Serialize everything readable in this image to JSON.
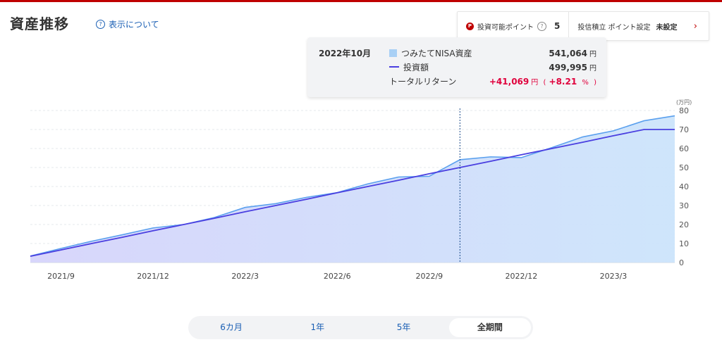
{
  "header": {
    "title": "資産推移",
    "about_label": "表示について"
  },
  "points_panel": {
    "points_label": "投資可能ポイント",
    "points_value": "5",
    "setting_label": "投信積立 ポイント設定",
    "setting_value": "未設定"
  },
  "tooltip": {
    "date": "2022年10月",
    "rows": [
      {
        "label": "つみたてNISA資産",
        "value": "541,064",
        "unit": "円"
      },
      {
        "label": "投資額",
        "value": "499,995",
        "unit": "円"
      }
    ],
    "return_label": "トータルリターン",
    "return_value": "+41,069",
    "return_unit": "円",
    "return_paren_open": "(",
    "return_pct": "+8.21",
    "return_pct_unit": "%",
    "return_paren_close": ")"
  },
  "tabs": [
    {
      "label": "6カ月",
      "active": false
    },
    {
      "label": "1年",
      "active": false
    },
    {
      "label": "5年",
      "active": false
    },
    {
      "label": "全期間",
      "active": true
    }
  ],
  "colors": {
    "brand": "#bf0000",
    "asset_line": "#5aa0ee",
    "asset_fill": "#cce4fb",
    "invest_line": "#4a3fe0",
    "positive": "#e0003c"
  },
  "chart_data": {
    "type": "area",
    "y_unit_label": "(万円)",
    "ylim": [
      0,
      80
    ],
    "y_ticks": [
      0,
      10,
      20,
      30,
      40,
      50,
      60,
      70,
      80
    ],
    "x_ticks": [
      "2021/9",
      "2021/12",
      "2022/3",
      "2022/6",
      "2022/9",
      "2022/12",
      "2023/3"
    ],
    "x": [
      "2021/8",
      "2021/9",
      "2021/10",
      "2021/11",
      "2021/12",
      "2022/1",
      "2022/2",
      "2022/3",
      "2022/4",
      "2022/5",
      "2022/6",
      "2022/7",
      "2022/8",
      "2022/9",
      "2022/10",
      "2022/11",
      "2022/12",
      "2023/1",
      "2023/2",
      "2023/3",
      "2023/4",
      "2023/5"
    ],
    "series": [
      {
        "name": "つみたてNISA資産",
        "type": "area",
        "values": [
          3.4,
          7.4,
          11.2,
          14.6,
          18.2,
          20.0,
          23.7,
          29.0,
          31.0,
          34.3,
          36.8,
          41.4,
          45.0,
          45.4,
          54.1,
          55.6,
          55.2,
          60.5,
          66.1,
          69.3,
          74.6,
          77.2
        ]
      },
      {
        "name": "投資額",
        "type": "line",
        "values": [
          3.3,
          6.6,
          10.0,
          13.3,
          16.7,
          20.0,
          23.3,
          26.7,
          30.0,
          33.3,
          36.7,
          40.0,
          43.3,
          46.7,
          50.0,
          53.3,
          56.7,
          60.0,
          63.3,
          66.7,
          70.0,
          70.0
        ]
      }
    ],
    "highlight": "2022/10"
  }
}
